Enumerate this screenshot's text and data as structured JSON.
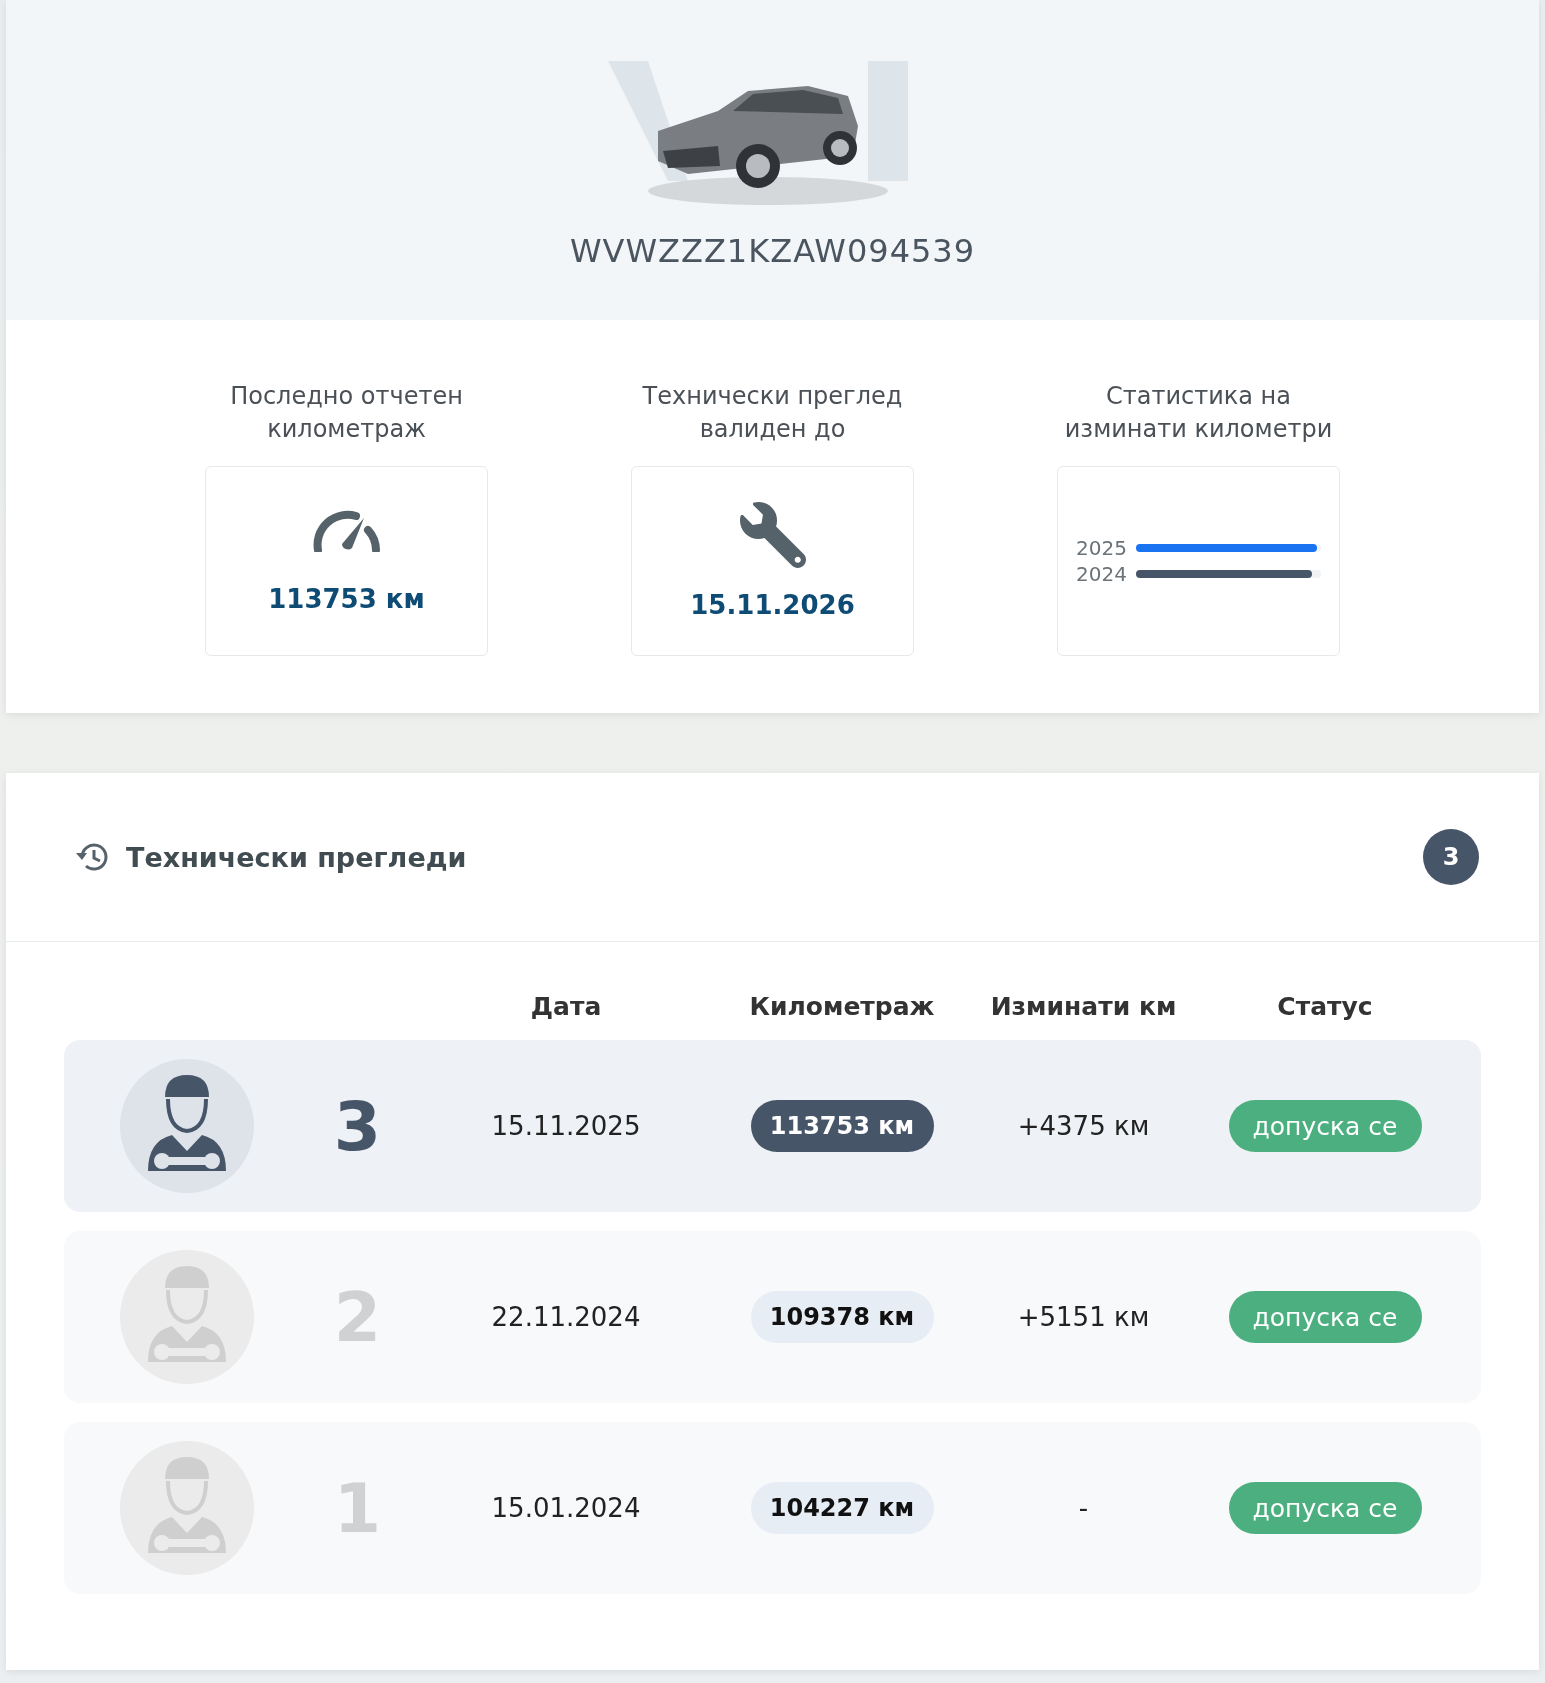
{
  "vehicle": {
    "vin": "WVWZZZ1KZAW094539"
  },
  "stats": [
    {
      "kind": "mileage",
      "title": "Последно отчетен километраж",
      "value": "113753 км"
    },
    {
      "kind": "inspection",
      "title": "Технически преглед валиден до",
      "value": "15.11.2026"
    },
    {
      "kind": "bars",
      "title": "Статистика на изминати километри",
      "bars": [
        {
          "label": "2025",
          "level": 0.98,
          "color": "#1a73f0"
        },
        {
          "label": "2024",
          "level": 0.95,
          "color": "#475569"
        }
      ]
    }
  ],
  "inspections": {
    "title": "Технически прегледи",
    "count": "3",
    "columns": [
      "Дата",
      "Километраж",
      "Изминати км",
      "Статус"
    ],
    "rows": [
      {
        "number": "3",
        "date": "15.11.2025",
        "mileage": "113753 км",
        "diff": "+4375 км",
        "status": "допуска се",
        "selected": true
      },
      {
        "number": "2",
        "date": "22.11.2024",
        "mileage": "109378 км",
        "diff": "+5151 км",
        "status": "допуска се",
        "selected": false
      },
      {
        "number": "1",
        "date": "15.01.2024",
        "mileage": "104227 км",
        "diff": "-",
        "status": "допуска се",
        "selected": false
      }
    ]
  }
}
